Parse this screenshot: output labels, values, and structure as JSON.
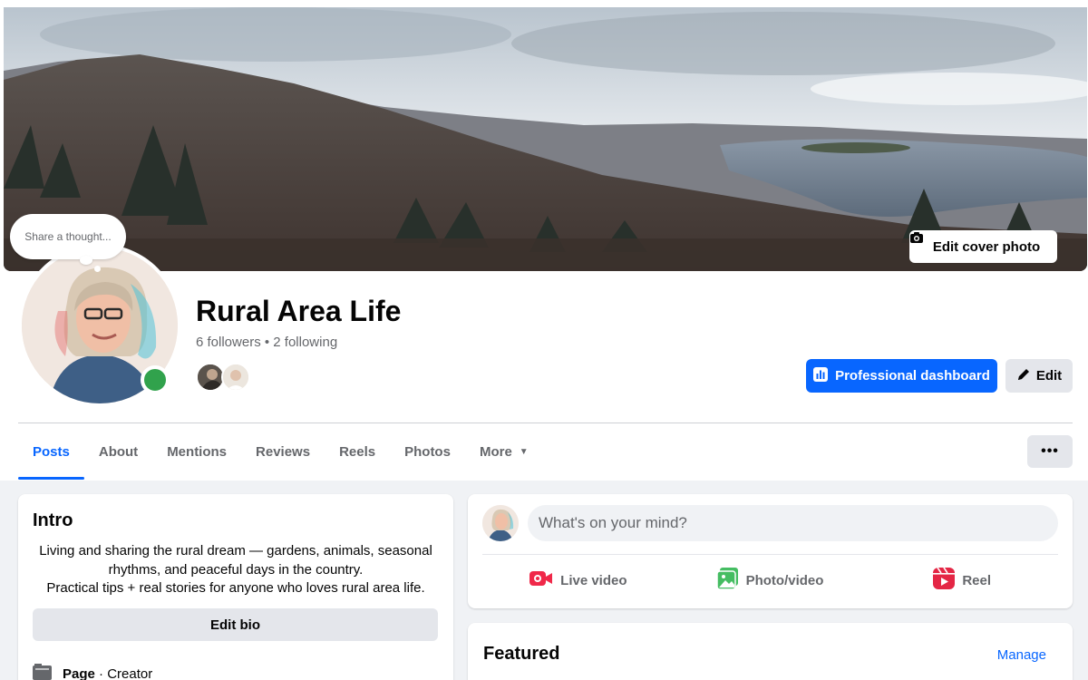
{
  "cover": {
    "edit_label": "Edit cover photo"
  },
  "thought": {
    "placeholder": "Share a thought..."
  },
  "profile": {
    "name": "Rural Area Life",
    "followers_text": "6 followers • 2 following",
    "online_status_color": "#31a24c"
  },
  "actions": {
    "professional_dashboard_label": "Professional dashboard",
    "edit_label": "Edit"
  },
  "tabs": [
    {
      "label": "Posts",
      "active": true
    },
    {
      "label": "About"
    },
    {
      "label": "Mentions"
    },
    {
      "label": "Reviews"
    },
    {
      "label": "Reels"
    },
    {
      "label": "Photos"
    },
    {
      "label": "More"
    }
  ],
  "more_options_label": "•••",
  "intro": {
    "title": "Intro",
    "bio_line1": "Living and sharing the rural dream — gardens, animals, seasonal rhythms, and peaceful days in the country.",
    "bio_line2": "Practical tips + real stories for anyone who loves rural area life.",
    "edit_bio_label": "Edit bio",
    "page_type_label": "Page",
    "page_type_category": " · Creator"
  },
  "composer": {
    "placeholder": "What's on your mind?",
    "live_video_label": "Live video",
    "photo_video_label": "Photo/video",
    "reel_label": "Reel"
  },
  "featured": {
    "title": "Featured",
    "manage_label": "Manage"
  },
  "colors": {
    "accent": "#0866ff",
    "background": "#f0f2f5",
    "live_red": "#f02849",
    "photo_green": "#45bd62",
    "reel_pink": "#e42645"
  }
}
